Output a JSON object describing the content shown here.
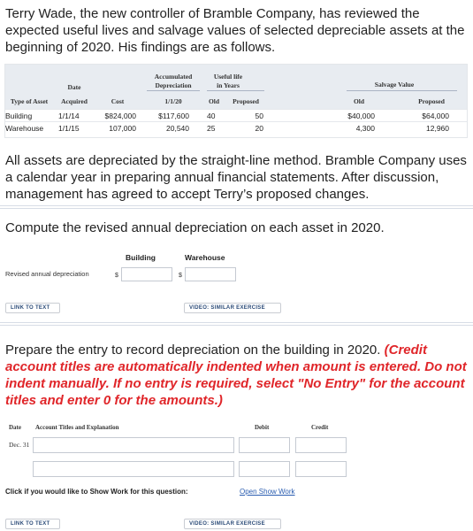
{
  "intro_text": "Terry Wade, the new controller of Bramble Company, has reviewed the expected useful lives and salvage values of selected depreciable assets at the beginning of 2020. His findings are as follows.",
  "assets_table": {
    "headers": {
      "type": "Type of Asset",
      "date_top": "Date",
      "date_bottom": "Acquired",
      "cost": "Cost",
      "accum_top": "Accumulated",
      "accum_mid": "Depreciation",
      "accum_date": "1/1/20",
      "useful_top": "Useful life",
      "useful_mid": "in Years",
      "useful_old": "Old",
      "useful_proposed": "Proposed",
      "salvage_top": "Salvage Value",
      "salvage_old": "Old",
      "salvage_proposed": "Proposed"
    },
    "rows": [
      {
        "type": "Building",
        "date": "1/1/14",
        "cost": "$824,000",
        "accum": "$117,600",
        "life_old": "40",
        "life_proposed": "50",
        "salvage_old": "$40,000",
        "salvage_proposed": "$64,000"
      },
      {
        "type": "Warehouse",
        "date": "1/1/15",
        "cost": "107,000",
        "accum": "20,540",
        "life_old": "25",
        "life_proposed": "20",
        "salvage_old": "4,300",
        "salvage_proposed": "12,960"
      }
    ]
  },
  "method_text": "All assets are depreciated by the straight-line method. Bramble Company uses a calendar year in preparing annual financial statements. After discussion, management has agreed to accept Terry’s proposed changes.",
  "part1": {
    "prompt": "Compute the revised annual depreciation on each asset in 2020.",
    "col_building": "Building",
    "col_warehouse": "Warehouse",
    "row_label": "Revised annual depreciation",
    "currency": "$",
    "building_value": "",
    "warehouse_value": "",
    "link_text": "LINK TO TEXT",
    "video_text": "VIDEO: SIMILAR EXERCISE"
  },
  "part2": {
    "prompt": "Prepare the entry to record depreciation on the building in 2020.",
    "instruction": "(Credit account titles are automatically indented when amount is entered. Do not indent manually. If no entry is required, select \"No Entry\" for the account titles and enter 0 for the amounts.)",
    "col_date": "Date",
    "col_account": "Account Titles and Explanation",
    "col_debit": "Debit",
    "col_credit": "Credit",
    "date_value": "Dec. 31",
    "show_work_label": "Click if you would like to Show Work for this question:",
    "show_work_link": "Open Show Work",
    "link_text": "LINK TO TEXT",
    "video_text": "VIDEO: SIMILAR EXERCISE"
  }
}
